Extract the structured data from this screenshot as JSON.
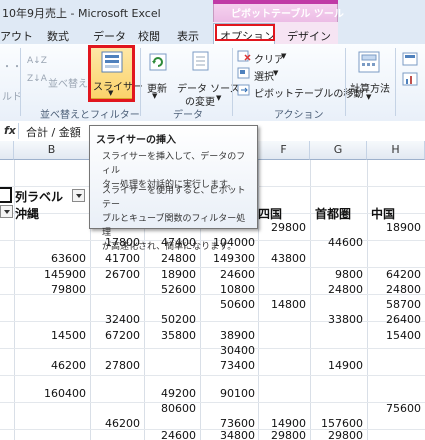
{
  "window": {
    "title": "10年9月売上 - Microsoft Excel"
  },
  "context_group": {
    "label": "ピボットテーブル ツール"
  },
  "tabs": [
    {
      "label": "アウト"
    },
    {
      "label": "数式"
    },
    {
      "label": "データ"
    },
    {
      "label": "校閲"
    },
    {
      "label": "表示"
    },
    {
      "label": "オプション"
    },
    {
      "label": "デザイン"
    }
  ],
  "ribbon": {
    "partial_left_1": "・・",
    "partial_left_2": "ルド",
    "sort_za_icon": "Z↓A",
    "sort_label": "並べ替え",
    "slicer_label": "スライサー",
    "slicer_arrow": "▼",
    "group_sort_filter": "並べ替えとフィルター",
    "refresh_label": "更新",
    "change_source_label_1": "データ ソース",
    "change_source_label_2": "の変更",
    "group_data": "データ",
    "clear_label": "クリア",
    "select_label": "選択",
    "move_label": "ピボットテーブルの移動",
    "group_actions": "アクション",
    "calc_label": "計算方法",
    "arrow": "▼",
    "colors": {
      "accent_red": "#e1161e",
      "context_pink": "#c03aa6",
      "highlight": "#fbd36b"
    }
  },
  "formula_bar": {
    "fx": "fx",
    "value": "合計 / 金額"
  },
  "columns": [
    "B",
    "F",
    "G",
    "H"
  ],
  "grid": {
    "row_label_header": "列ラベル",
    "row_first_value": "沖縄",
    "region_headers": [
      "四国",
      "首都圏",
      "中国"
    ],
    "cells": [
      [
        "",
        "",
        "",
        "",
        "29800",
        "",
        "18900"
      ],
      [
        "",
        "17800",
        "47400",
        "104000",
        "",
        "44600",
        ""
      ],
      [
        "63600",
        "41700",
        "24800",
        "149300",
        "43800",
        "",
        ""
      ],
      [
        "145900",
        "26700",
        "18900",
        "24600",
        "",
        "9800",
        "64200"
      ],
      [
        "79800",
        "",
        "52600",
        "10800",
        "",
        "24800",
        "24800"
      ],
      [
        "",
        "",
        "",
        "50600",
        "14800",
        "",
        "58700"
      ],
      [
        "",
        "32400",
        "50200",
        "",
        "",
        "33800",
        "26400"
      ],
      [
        "14500",
        "67200",
        "35800",
        "38900",
        "",
        "",
        "15400"
      ],
      [
        "",
        "",
        "",
        "30400",
        "",
        "",
        ""
      ],
      [
        "46200",
        "27800",
        "",
        "73400",
        "",
        "14900",
        ""
      ],
      [
        "",
        "",
        "",
        "",
        "",
        "",
        ""
      ],
      [
        "160400",
        "",
        "49200",
        "90100",
        "",
        "",
        ""
      ],
      [
        "",
        "",
        "80600",
        "",
        "",
        "",
        "75600"
      ],
      [
        "",
        "46200",
        "",
        "73600",
        "14900",
        "157600",
        ""
      ],
      [
        "",
        "",
        "24600",
        "34800",
        "29800",
        "29800",
        ""
      ]
    ]
  },
  "tooltip": {
    "title": "スライサーの挿入",
    "lines_1": [
      "スライサーを挿入して、データのフィル",
      "ター処理を対話的に実行します。"
    ],
    "lines_2": [
      "スライサーを使用すると、ピボットテー",
      "ブルとキューブ関数のフィルター処理",
      "が高速化され、簡単になります。"
    ]
  }
}
